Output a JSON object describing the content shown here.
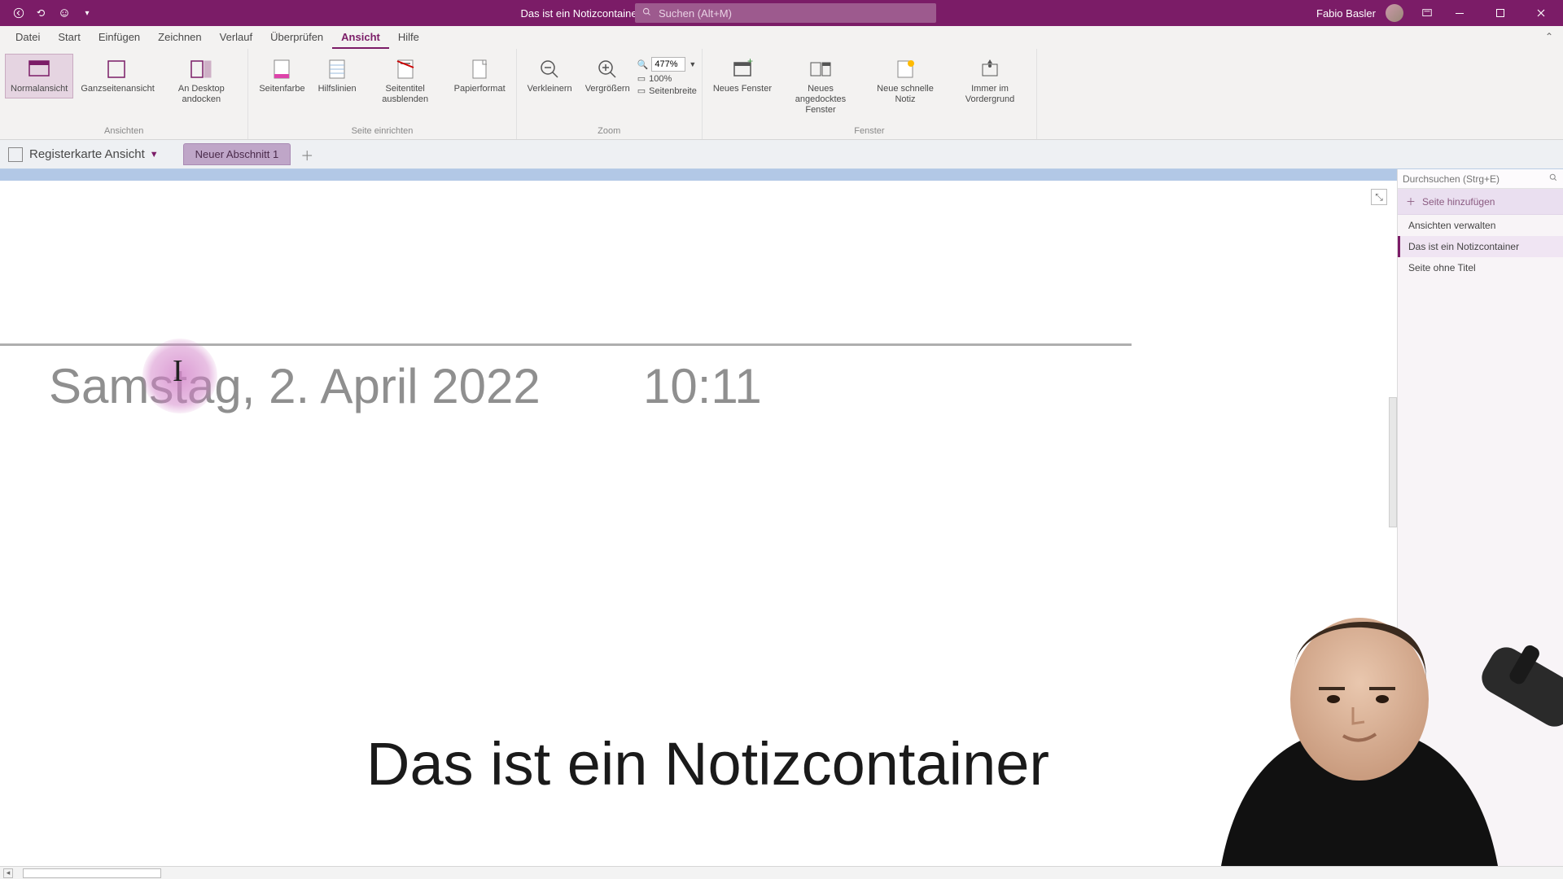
{
  "titlebar": {
    "doc_title": "Das ist ein Notizcontainer  -  OneNote",
    "search_placeholder": "Suchen (Alt+M)",
    "user_name": "Fabio Basler"
  },
  "menu": {
    "items": [
      "Datei",
      "Start",
      "Einfügen",
      "Zeichnen",
      "Verlauf",
      "Überprüfen",
      "Ansicht",
      "Hilfe"
    ],
    "active_index": 6
  },
  "ribbon": {
    "groups": [
      {
        "label": "Ansichten",
        "buttons": [
          {
            "key": "normal",
            "label": "Normalansicht",
            "active": true
          },
          {
            "key": "fullpage",
            "label": "Ganzseitenansicht"
          },
          {
            "key": "dock",
            "label": "An Desktop andocken"
          }
        ]
      },
      {
        "label": "Seite einrichten",
        "buttons": [
          {
            "key": "pagecolor",
            "label": "Seitenfarbe"
          },
          {
            "key": "rulelines",
            "label": "Hilfslinien"
          },
          {
            "key": "hidetitle",
            "label": "Seitentitel ausblenden"
          },
          {
            "key": "papersize",
            "label": "Papierformat"
          }
        ]
      },
      {
        "label": "Zoom",
        "buttons": [
          {
            "key": "zoomout",
            "label": "Verkleinern"
          },
          {
            "key": "zoomin",
            "label": "Vergrößern"
          }
        ],
        "zoom_value": "477%",
        "zoom_100": "100%",
        "zoom_width": "Seitenbreite"
      },
      {
        "label": "Fenster",
        "buttons": [
          {
            "key": "newwin",
            "label": "Neues Fenster"
          },
          {
            "key": "newdock",
            "label": "Neues angedocktes Fenster"
          },
          {
            "key": "quicknote",
            "label": "Neue schnelle Notiz"
          },
          {
            "key": "ontop",
            "label": "Immer im Vordergrund"
          }
        ]
      }
    ]
  },
  "notebook": {
    "title": "Registerkarte Ansicht",
    "section_tab": "Neuer Abschnitt 1"
  },
  "page": {
    "date": "Samstag, 2. April 2022",
    "time": "10:11",
    "note_body": "Das ist ein Notizcontainer"
  },
  "pagepane": {
    "search_placeholder": "Durchsuchen (Strg+E)",
    "add_label": "Seite hinzufügen",
    "items": [
      {
        "label": "Ansichten verwalten",
        "selected": false
      },
      {
        "label": "Das ist ein Notizcontainer",
        "selected": true
      },
      {
        "label": "Seite ohne Titel",
        "selected": false
      }
    ]
  }
}
